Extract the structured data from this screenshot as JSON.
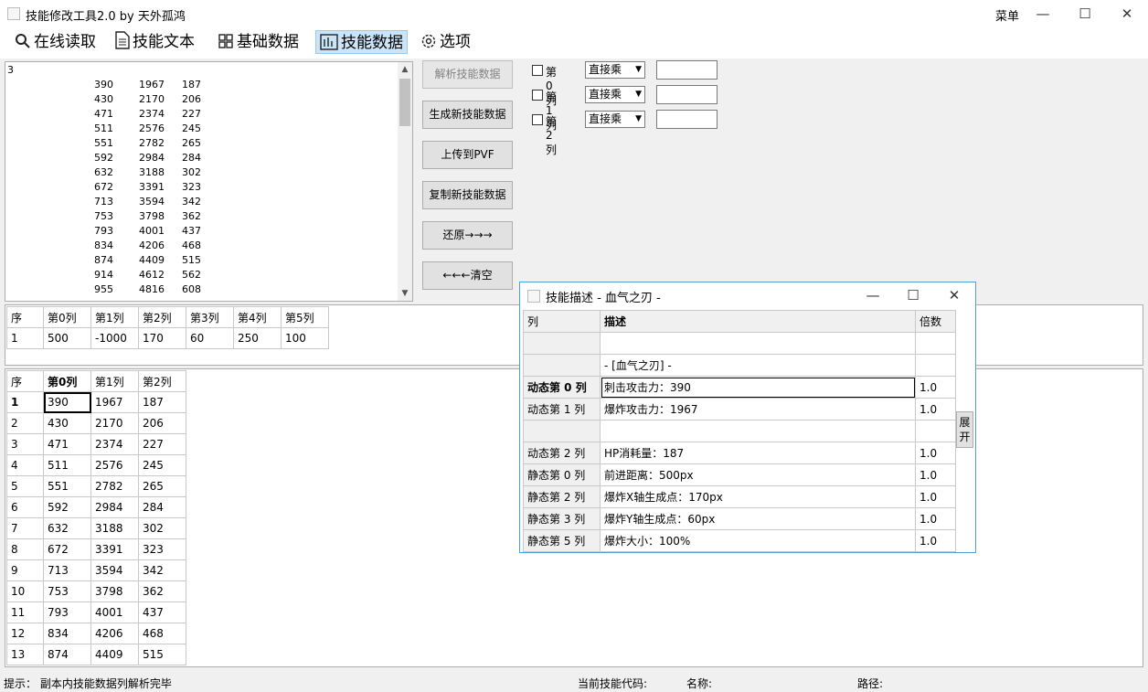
{
  "window": {
    "title": "技能修改工具2.0 by 天外孤鸿",
    "menu_label": "菜单",
    "minimize": "—",
    "maximize": "☐",
    "close": "✕"
  },
  "toolbar": {
    "items": [
      {
        "label": "在线读取",
        "icon": "search-icon"
      },
      {
        "label": "技能文本",
        "icon": "document-icon"
      },
      {
        "label": "基础数据",
        "icon": "grid-icon"
      },
      {
        "label": "技能数据",
        "icon": "chart-icon",
        "active": true
      },
      {
        "label": "选项",
        "icon": "gear-icon"
      }
    ]
  },
  "raw_text": {
    "first_line": "3",
    "rows": [
      [
        "390",
        "1967",
        "187"
      ],
      [
        "430",
        "2170",
        "206"
      ],
      [
        "471",
        "2374",
        "227"
      ],
      [
        "511",
        "2576",
        "245"
      ],
      [
        "551",
        "2782",
        "265"
      ],
      [
        "592",
        "2984",
        "284"
      ],
      [
        "632",
        "3188",
        "302"
      ],
      [
        "672",
        "3391",
        "323"
      ],
      [
        "713",
        "3594",
        "342"
      ],
      [
        "753",
        "3798",
        "362"
      ],
      [
        "793",
        "4001",
        "437"
      ],
      [
        "834",
        "4206",
        "468"
      ],
      [
        "874",
        "4409",
        "515"
      ],
      [
        "914",
        "4612",
        "562"
      ],
      [
        "955",
        "4816",
        "608"
      ]
    ]
  },
  "actions": {
    "parse": "解析技能数据",
    "generate": "生成新技能数据",
    "upload": "上传到PVF",
    "copy": "复制新技能数据",
    "restore": "还原→→→",
    "clear": "←←←清空"
  },
  "column_ops": [
    {
      "label": "第0列",
      "mode": "直接乘",
      "value": ""
    },
    {
      "label": "第1列",
      "mode": "直接乘",
      "value": ""
    },
    {
      "label": "第2列",
      "mode": "直接乘",
      "value": ""
    }
  ],
  "static_table": {
    "headers": [
      "序",
      "第0列",
      "第1列",
      "第2列",
      "第3列",
      "第4列",
      "第5列"
    ],
    "rows": [
      [
        "1",
        "500",
        "-1000",
        "170",
        "60",
        "250",
        "100"
      ]
    ]
  },
  "dynamic_table": {
    "headers": [
      "序",
      "第0列",
      "第1列",
      "第2列"
    ],
    "rows": [
      [
        "1",
        "390",
        "1967",
        "187"
      ],
      [
        "2",
        "430",
        "2170",
        "206"
      ],
      [
        "3",
        "471",
        "2374",
        "227"
      ],
      [
        "4",
        "511",
        "2576",
        "245"
      ],
      [
        "5",
        "551",
        "2782",
        "265"
      ],
      [
        "6",
        "592",
        "2984",
        "284"
      ],
      [
        "7",
        "632",
        "3188",
        "302"
      ],
      [
        "8",
        "672",
        "3391",
        "323"
      ],
      [
        "9",
        "713",
        "3594",
        "342"
      ],
      [
        "10",
        "753",
        "3798",
        "362"
      ],
      [
        "11",
        "793",
        "4001",
        "437"
      ],
      [
        "12",
        "834",
        "4206",
        "468"
      ],
      [
        "13",
        "874",
        "4409",
        "515"
      ]
    ]
  },
  "dialog": {
    "title": "技能描述 - 血气之刃 -",
    "headers": [
      "列",
      "描述",
      "倍数"
    ],
    "rows": [
      [
        "",
        "",
        ""
      ],
      [
        "",
        "- [血气之刃] -",
        ""
      ],
      [
        "动态第 0 列",
        "刺击攻击力：390",
        "1.0"
      ],
      [
        "动态第 1 列",
        "爆炸攻击力：1967",
        "1.0"
      ],
      [
        "",
        "",
        ""
      ],
      [
        "动态第 2 列",
        "HP消耗量：187",
        "1.0"
      ],
      [
        "静态第 0 列",
        "前进距离：500px",
        "1.0"
      ],
      [
        "静态第 2 列",
        "爆炸X轴生成点：170px",
        "1.0"
      ],
      [
        "静态第 3 列",
        "爆炸Y轴生成点：60px",
        "1.0"
      ],
      [
        "静态第 5 列",
        "爆炸大小：100%",
        "1.0"
      ]
    ],
    "expand_label": "展开"
  },
  "status": {
    "hint": "提示：  副本内技能数据列解析完毕",
    "skill_code": "当前技能代码:",
    "name": "名称:",
    "path": "路径:"
  }
}
